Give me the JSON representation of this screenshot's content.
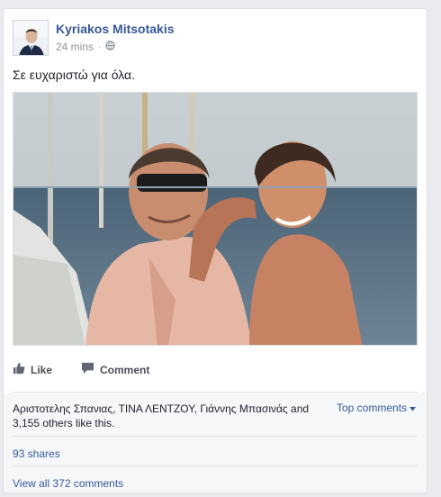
{
  "post": {
    "author": "Kyriakos Mitsotakis",
    "time": "24 mins",
    "separator": "·",
    "privacy_icon": "globe-icon",
    "text": "Σε ευχαριστώ για όλα."
  },
  "actions": {
    "like_label": "Like",
    "comment_label": "Comment"
  },
  "reactions": {
    "names": [
      "Αριστοτελης Σπανιας",
      "ΤΙΝΑ ΛΕΝΤΖΟΥ",
      "Γιάννης Μπασινάς"
    ],
    "sep_1": ", ",
    "sep_2": ", ",
    "and_text": " and",
    "others_text": "3,155 others like this.",
    "top_comments_label": "Top comments"
  },
  "shares_label": "93 shares",
  "view_all_label": "View all 372 comments",
  "colors": {
    "link": "#365899",
    "muted": "#90949c",
    "panel": "#f6f7f9",
    "background": "#e9ebee"
  }
}
